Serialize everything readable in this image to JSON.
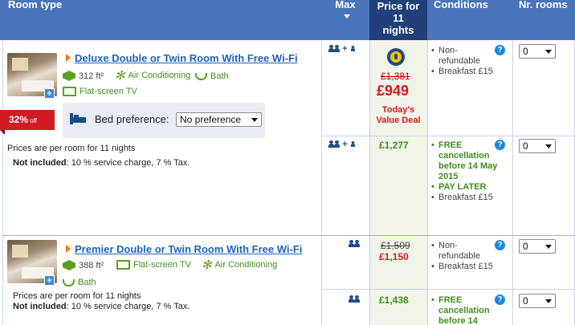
{
  "header": {
    "room_type": "Room type",
    "max": "Max",
    "price_line1": "Price for",
    "price_line2": "11",
    "price_line3": "nights",
    "conditions": "Conditions",
    "nr_rooms": "Nr. rooms"
  },
  "rooms": [
    {
      "title": "Deluxe Double or Twin Room With Free Wi-Fi",
      "size": "312 ft²",
      "facilities": [
        "Air Conditioning",
        "Bath",
        "Flat-screen TV"
      ],
      "bed_pref_label": "Bed preference:",
      "bed_pref_value": "No preference",
      "discount_value": "32%",
      "discount_suffix": "off",
      "prices_note": "Prices are per room for 11 nights",
      "not_included_label": "Not included",
      "not_included_text": ": 10 % service charge, 7 % Tax.",
      "offers": [
        {
          "occupancy": "+",
          "old_price": "£1,381",
          "price": "£949",
          "deal_line1": "Today's",
          "deal_line2": "Value Deal",
          "conditions": [
            "Non-refundable",
            "Breakfast £15"
          ],
          "qty": "0"
        },
        {
          "occupancy": "+",
          "price": "£1,277",
          "conditions_free": "FREE cancellation before 14 May 2015",
          "conditions_pay": "PAY LATER",
          "conditions_extra": "Breakfast £15",
          "qty": "0"
        }
      ]
    },
    {
      "title": "Premier Double or Twin Room With Free Wi-Fi",
      "size": "388 ft²",
      "facilities": [
        "Flat-screen TV",
        "Air Conditioning",
        "Bath"
      ],
      "prices_note": "Prices are per room for 11 nights",
      "not_included_label": "Not included",
      "not_included_text": ": 10 % service charge, 7 % Tax.",
      "offers": [
        {
          "old_price": "£1,509",
          "price": "£1,150",
          "conditions": [
            "Non-refundable",
            "Breakfast £15"
          ],
          "qty": "0"
        },
        {
          "price": "£1,438",
          "conditions_free": "FREE cancellation before 14",
          "qty": "0"
        }
      ]
    }
  ],
  "colors": {
    "header": "#4a74b9",
    "price_header": "#213f7a",
    "price_red": "#d31921",
    "price_green": "#3e8f1d",
    "link": "#1d62c0"
  }
}
